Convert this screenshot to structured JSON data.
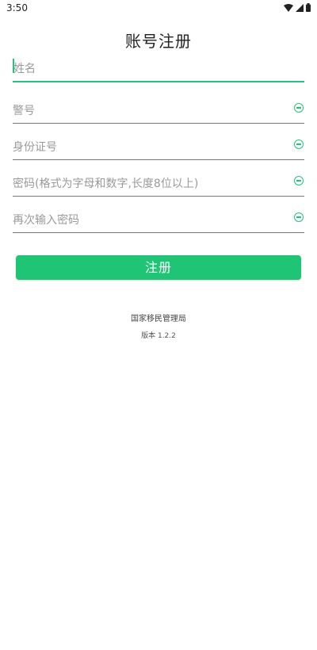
{
  "status_bar": {
    "time": "3:50"
  },
  "page": {
    "title": "账号注册"
  },
  "form": {
    "fields": [
      {
        "placeholder": "姓名"
      },
      {
        "placeholder": "警号"
      },
      {
        "placeholder": "身份证号"
      },
      {
        "placeholder": "密码(格式为字母和数字,长度8位以上)"
      },
      {
        "placeholder": "再次输入密码"
      }
    ],
    "submit_label": "注册"
  },
  "footer": {
    "organization": "国家移民管理局",
    "version": "版本 1.2.2"
  },
  "colors": {
    "accent": "#21c47a",
    "button": "#1fc574"
  },
  "icons": {
    "wifi": "wifi-icon",
    "signal": "signal-icon",
    "battery": "battery-icon",
    "toggle": "clear-icon"
  }
}
